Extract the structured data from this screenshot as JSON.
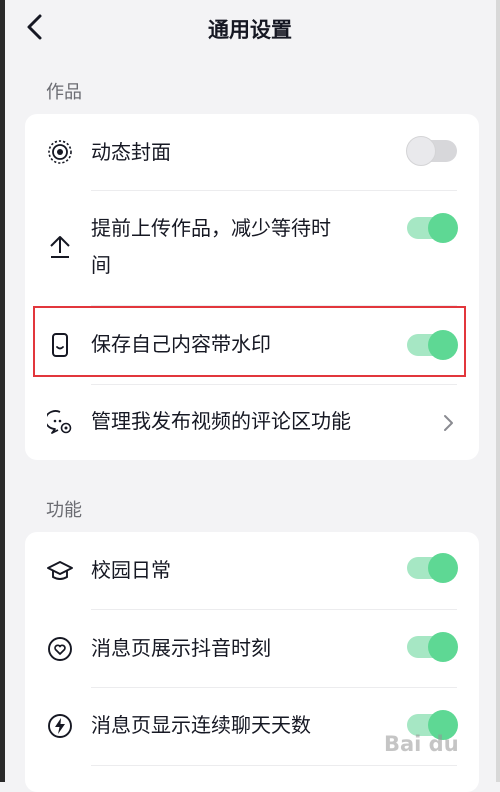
{
  "header": {
    "title": "通用设置"
  },
  "sections": [
    {
      "label": "作品",
      "items": [
        {
          "label": "动态封面",
          "icon": "live-cover-icon",
          "control": "toggle",
          "enabled": false
        },
        {
          "label_line1": "提前上传作品，减少等待时",
          "label_line2": "间",
          "icon": "upload-icon",
          "control": "toggle",
          "enabled": true
        },
        {
          "label": "保存自己内容带水印",
          "icon": "phone-save-icon",
          "control": "toggle",
          "enabled": true,
          "highlighted": true
        },
        {
          "label": "管理我发布视频的评论区功能",
          "icon": "comment-settings-icon",
          "control": "chevron"
        }
      ]
    },
    {
      "label": "功能",
      "items": [
        {
          "label": "校园日常",
          "icon": "graduation-cap-icon",
          "control": "toggle",
          "enabled": true
        },
        {
          "label": "消息页展示抖音时刻",
          "icon": "heart-moment-icon",
          "control": "toggle",
          "enabled": true
        },
        {
          "label": "消息页显示连续聊天天数",
          "icon": "streak-lightning-icon",
          "control": "toggle",
          "enabled": true
        }
      ]
    }
  ],
  "watermark": {
    "text": "Bai du"
  },
  "colors": {
    "toggle_on": "#5ed894",
    "toggle_on_track": "#a6e7c4",
    "highlight": "#e2363c"
  }
}
